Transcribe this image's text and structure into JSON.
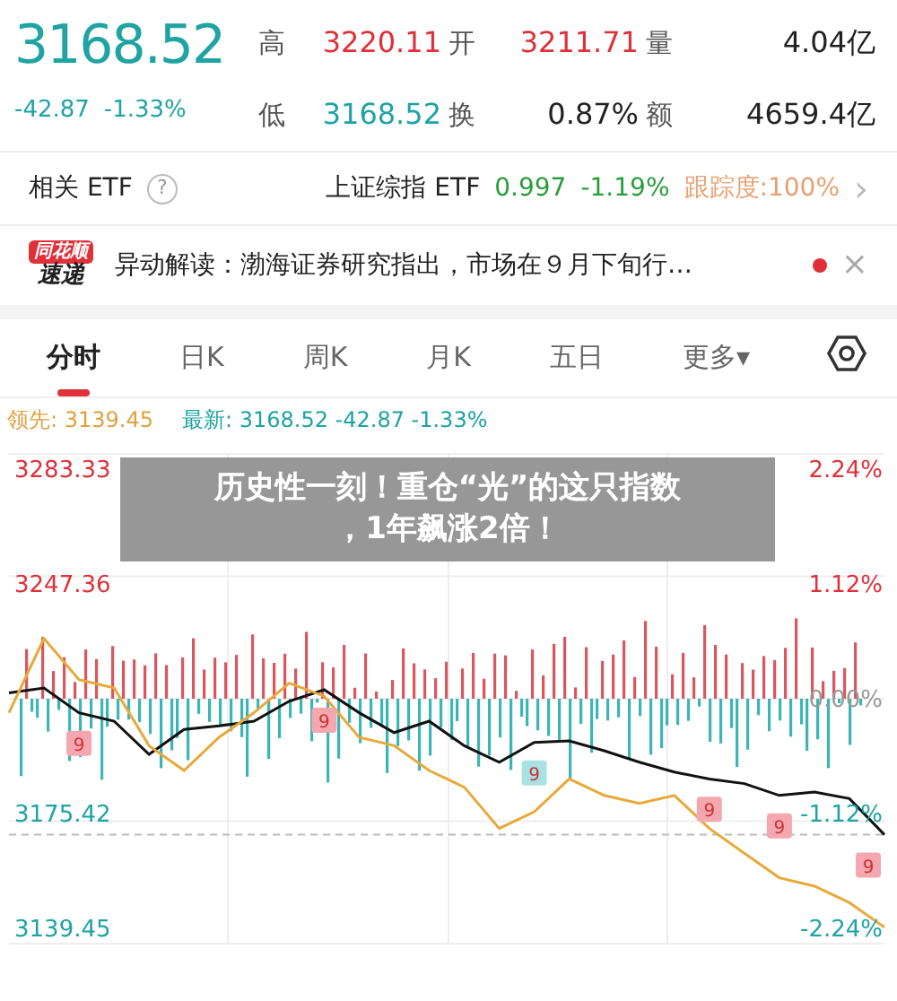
{
  "quote": {
    "price": "3168.52",
    "change": "-42.87",
    "change_pct": "-1.33%",
    "color": "#1fa3a3"
  },
  "stats": [
    {
      "label": "高",
      "value": "3220.11",
      "color": "#e0303a"
    },
    {
      "label": "开",
      "value": "3211.71",
      "color": "#e0303a"
    },
    {
      "label": "量",
      "value": "4.04亿",
      "color": "#222222"
    },
    {
      "label": "低",
      "value": "3168.52",
      "color": "#1fa3a3"
    },
    {
      "label": "换",
      "value": "0.87%",
      "color": "#222222"
    },
    {
      "label": "额",
      "value": "4659.4亿",
      "color": "#222222"
    }
  ],
  "etf": {
    "label": "相关 ETF",
    "help": "?",
    "name": "上证综指 ETF",
    "price": "0.997",
    "change": "-1.19%",
    "tracking": "跟踪度:100%",
    "arrow": "›"
  },
  "news": {
    "logo_top": "同花顺",
    "logo_bottom": "速递",
    "text": "异动解读：渤海证券研究指出，市场在９月下旬行…",
    "unread": true,
    "close": "×"
  },
  "tabs": [
    {
      "label": "分时",
      "selected": true
    },
    {
      "label": "日K",
      "selected": false
    },
    {
      "label": "周K",
      "selected": false
    },
    {
      "label": "月K",
      "selected": false
    },
    {
      "label": "五日",
      "selected": false
    },
    {
      "label": "更多▾",
      "selected": false
    }
  ],
  "legend": {
    "lead_value": ": 3139.45",
    "latest_value": ": 3168.52  -42.87  -1.33%"
  },
  "chart": {
    "chart_data": {
      "type": "line",
      "ylim": [
        3139.45,
        3283.33
      ],
      "yticks": [
        {
          "value": 3283.33,
          "label": "3283.33"
        },
        {
          "value": 3247.36,
          "label": "3247.36"
        },
        {
          "value": 3175.42,
          "label": "3175.42"
        },
        {
          "value": 3139.45,
          "label": "3139.45"
        }
      ],
      "series": [
        {
          "name": "最新",
          "color": "#111111",
          "values": [
            3212.9,
            3214.5,
            3206.7,
            3204.1,
            3193.7,
            3201.5,
            3202.6,
            3204.1,
            3210.3,
            3213.9,
            3206.7,
            3200.5,
            3204.1,
            3196.4,
            3191.2,
            3197.4,
            3197.9,
            3194.8,
            3191.2,
            3188.1,
            3186.0,
            3184.5,
            3180.8,
            3181.9,
            3179.8,
            3168.5
          ]
        },
        {
          "name": "领先",
          "color": "#e8a93a",
          "values": [
            3206.7,
            3230.0,
            3217.1,
            3214.5,
            3196.4,
            3188.6,
            3199.0,
            3206.7,
            3216.0,
            3211.9,
            3199.0,
            3196.4,
            3188.6,
            3183.4,
            3170.5,
            3175.7,
            3186.0,
            3180.8,
            3178.3,
            3180.8,
            3170.5,
            3162.7,
            3155.0,
            3152.4,
            3147.2,
            3139.5
          ]
        }
      ]
    },
    "right_labels": [
      {
        "label": "2.24%",
        "color": "#e0303a"
      },
      {
        "label": "1.12%",
        "color": "#e0303a"
      },
      {
        "label": "0.00%",
        "color": "#999999"
      },
      {
        "label": "-1.12%",
        "color": "#1fa3a3"
      },
      {
        "label": "-2.24%",
        "color": "#1fa3a3"
      }
    ],
    "markers": [
      {
        "label": "9",
        "color": "#f4a7ae"
      },
      {
        "label": "9",
        "color": "#f4a7ae"
      },
      {
        "label": "9",
        "color": "#a8e2e2"
      },
      {
        "label": "9",
        "color": "#f4a7ae"
      },
      {
        "label": "9",
        "color": "#f4a7ae"
      },
      {
        "label": "9",
        "color": "#f4a7ae"
      }
    ]
  },
  "headline": [
    "历史性一刻！重仓“光”的这只指数",
    "，1年飙涨2倍！"
  ]
}
